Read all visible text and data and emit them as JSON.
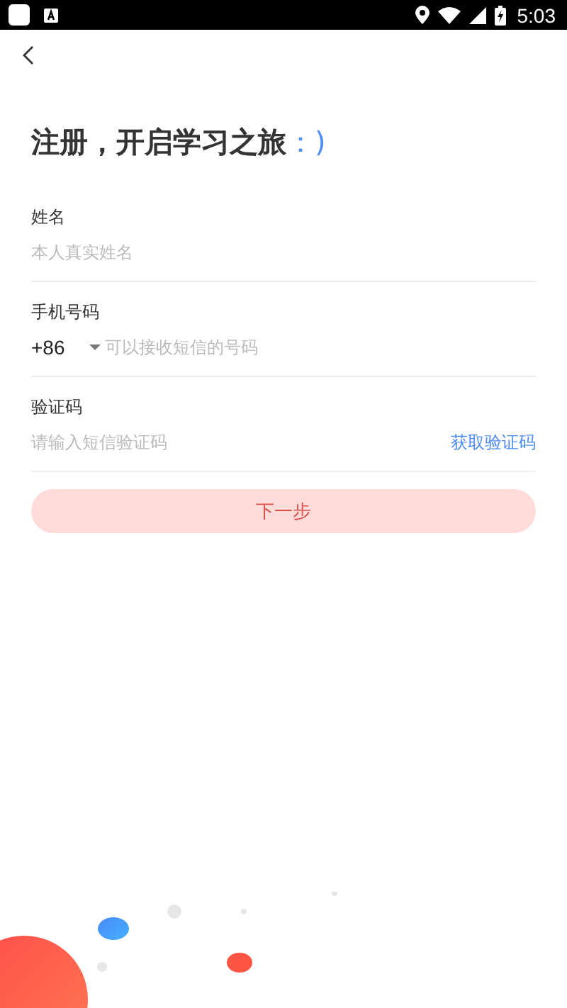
{
  "status_bar": {
    "time": "5:03"
  },
  "title": "注册，开启学习之旅",
  "title_emoticon": "：)",
  "fields": [
    {
      "kind": "text",
      "label": "姓名",
      "placeholder": "本人真实姓名"
    },
    {
      "kind": "phone",
      "label": "手机号码",
      "prefix": "+86",
      "placeholder": "可以接收短信的号码"
    },
    {
      "kind": "code",
      "label": "验证码",
      "placeholder": "请输入短信验证码",
      "action": "获取验证码"
    }
  ],
  "next_button": {
    "label": "下一步",
    "disabled": true
  }
}
